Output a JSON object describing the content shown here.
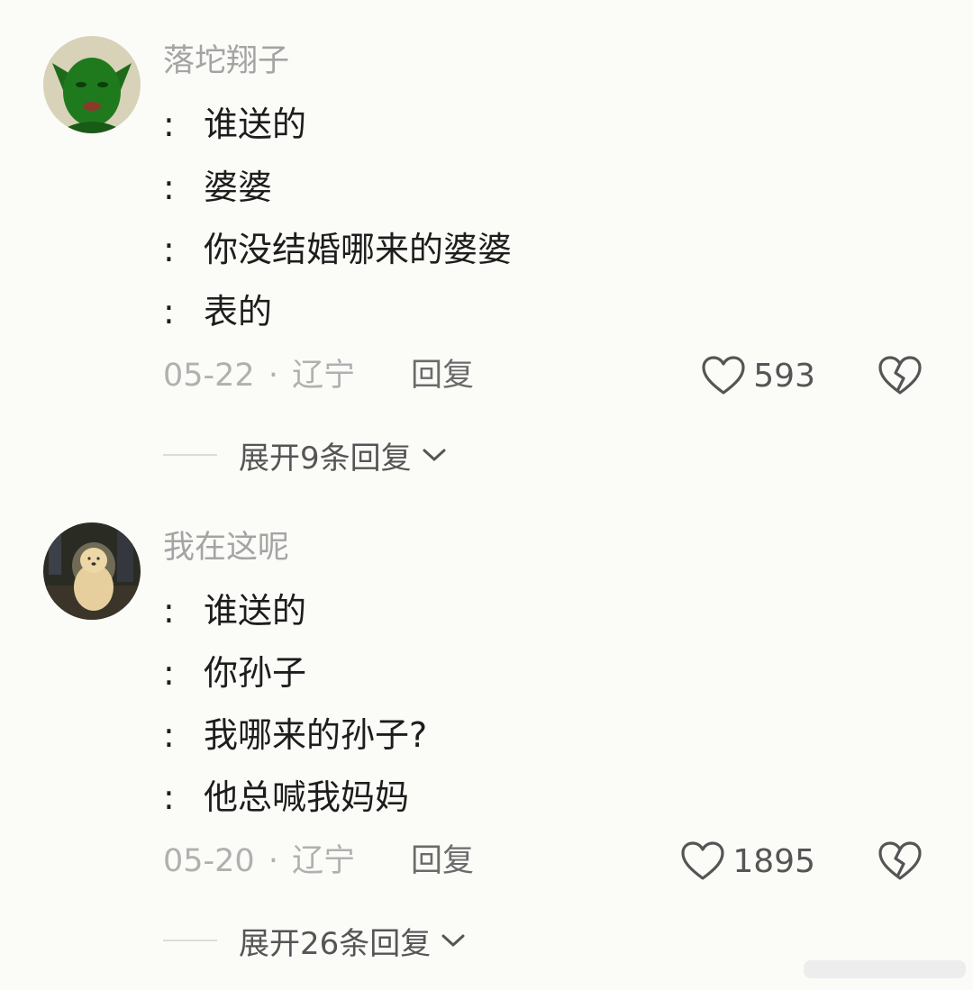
{
  "comments": [
    {
      "username": "落坨翔子",
      "lines": [
        "谁送的",
        "婆婆",
        "你没结婚哪来的婆婆",
        "表的"
      ],
      "date": "05-22",
      "separator": "·",
      "location": "辽宁",
      "reply_label": "回复",
      "likes": "593",
      "expand_label": "展开9条回复"
    },
    {
      "username": "我在这呢",
      "lines": [
        "谁送的",
        "你孙子",
        "我哪来的孙子?",
        "他总喊我妈妈"
      ],
      "date": "05-20",
      "separator": "·",
      "location": "辽宁",
      "reply_label": "回复",
      "likes": "1895",
      "expand_label": "展开26条回复"
    }
  ],
  "line_prefix": ":",
  "icons": {
    "like": "heart-outline-icon",
    "dislike": "broken-heart-icon",
    "expand": "chevron-down-icon"
  },
  "colors": {
    "background": "#fbfbf8",
    "username": "#a4a4a4",
    "body_text": "#1d1d1d",
    "meta_text": "#b0b0b0"
  }
}
